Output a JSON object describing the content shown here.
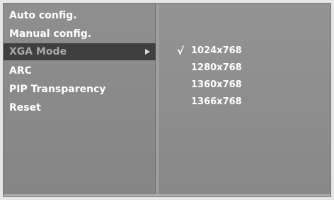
{
  "menu": {
    "items": [
      {
        "label": "Auto config."
      },
      {
        "label": "Manual config."
      },
      {
        "label": "XGA Mode"
      },
      {
        "label": "ARC"
      },
      {
        "label": "PIP Transparency"
      },
      {
        "label": "Reset"
      }
    ],
    "selected_index": 2
  },
  "submenu": {
    "options": [
      {
        "label": "1024x768",
        "checked": true
      },
      {
        "label": "1280x768",
        "checked": false
      },
      {
        "label": "1360x768",
        "checked": false
      },
      {
        "label": "1366x768",
        "checked": false
      }
    ],
    "check_glyph": "√"
  },
  "icons": {
    "selected_arrow": "right-arrow-icon",
    "checkmark": "checkmark-icon"
  },
  "colors": {
    "panel": "#8c8c8c",
    "highlight": "#3f3f3f",
    "text": "#ffffff",
    "selected_text": "#a9a9a9"
  }
}
